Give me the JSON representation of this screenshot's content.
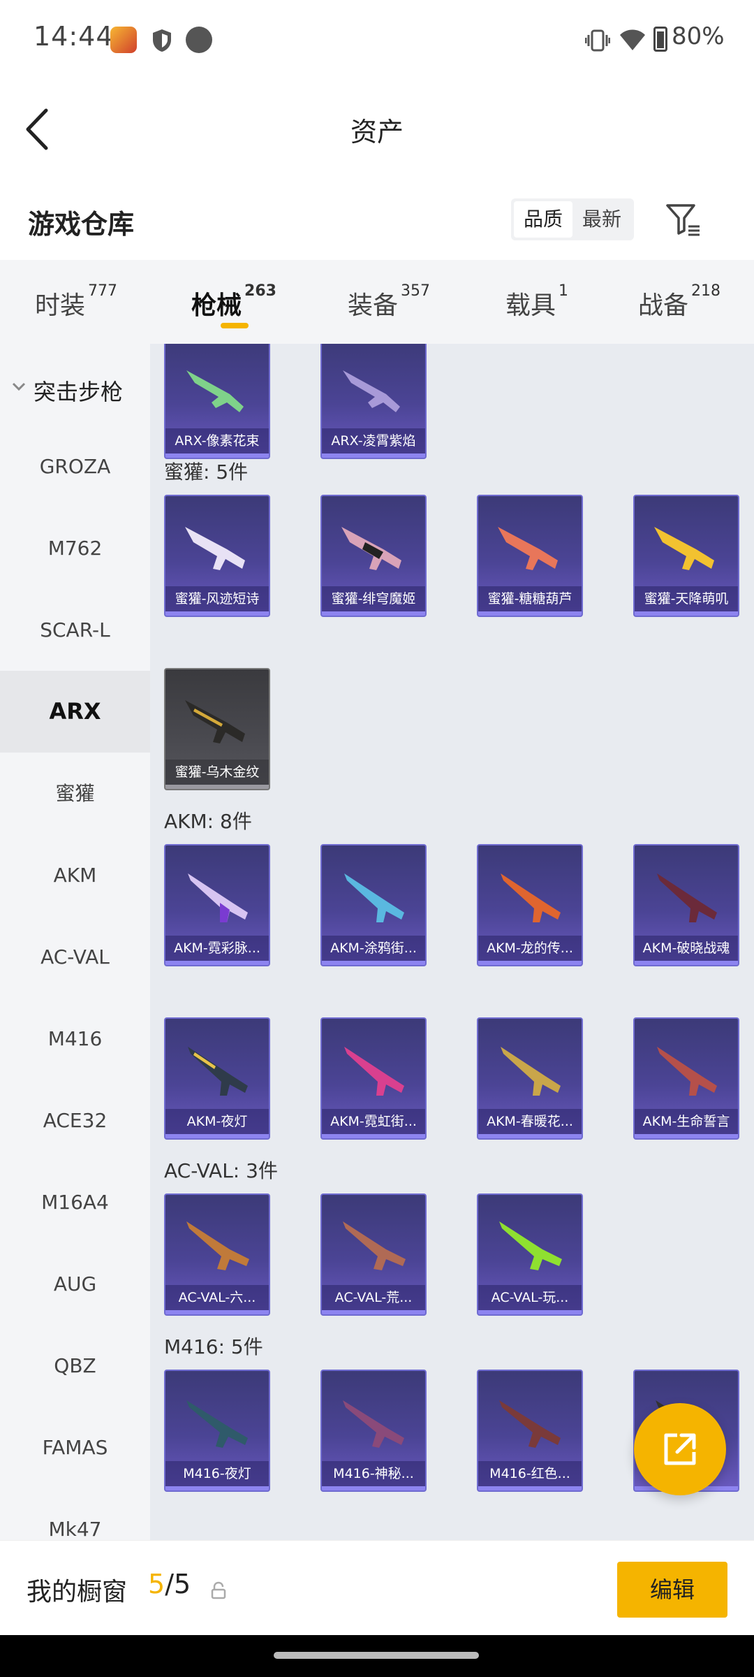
{
  "status_bar": {
    "time": "14:44",
    "battery": "80%"
  },
  "header": {
    "title": "资产"
  },
  "warehouse": {
    "title": "游戏仓库",
    "sort_options": [
      "品质",
      "最新"
    ],
    "active_sort": "品质"
  },
  "tabs": [
    {
      "label": "时装",
      "count": "777"
    },
    {
      "label": "枪械",
      "count": "263",
      "active": true
    },
    {
      "label": "装备",
      "count": "357"
    },
    {
      "label": "载具",
      "count": "1"
    },
    {
      "label": "战备",
      "count": "218"
    }
  ],
  "sidebar": {
    "category": "突击步枪",
    "items": [
      "GROZA",
      "M762",
      "SCAR-L",
      "ARX",
      "蜜獾",
      "AKM",
      "AC-VAL",
      "M416",
      "ACE32",
      "M16A4",
      "AUG",
      "QBZ",
      "FAMAS",
      "Mk47"
    ],
    "active_item": "ARX"
  },
  "sections": {
    "arx_cards": [
      "ARX-像素花束",
      "ARX-凌霄紫焰"
    ],
    "honeybadger": {
      "label": "蜜獾: 5件",
      "cards": [
        "蜜獾-风迹短诗",
        "蜜獾-绯穹魔姬",
        "蜜獾-糖糖葫芦",
        "蜜獾-天降萌叽",
        "蜜獾-乌木金纹"
      ]
    },
    "akm": {
      "label": "AKM: 8件",
      "cards": [
        "AKM-霓彩脉...",
        "AKM-涂鸦街...",
        "AKM-龙的传...",
        "AKM-破晓战魂",
        "AKM-夜灯",
        "AKM-霓虹街...",
        "AKM-春暖花...",
        "AKM-生命誓言"
      ]
    },
    "acval": {
      "label": "AC-VAL: 3件",
      "cards": [
        "AC-VAL-六...",
        "AC-VAL-荒...",
        "AC-VAL-玩..."
      ]
    },
    "m416": {
      "label": "M416: 5件",
      "cards": [
        "M416-夜灯",
        "M416-神秘...",
        "M416-红色..."
      ]
    }
  },
  "bottom_bar": {
    "label": "我的橱窗",
    "current": "5",
    "separator": "/",
    "total": "5",
    "edit_label": "编辑"
  },
  "colors": {
    "accent": "#f5b400",
    "card_bg": "#4b4495",
    "card_border": "#6f6bd0"
  }
}
